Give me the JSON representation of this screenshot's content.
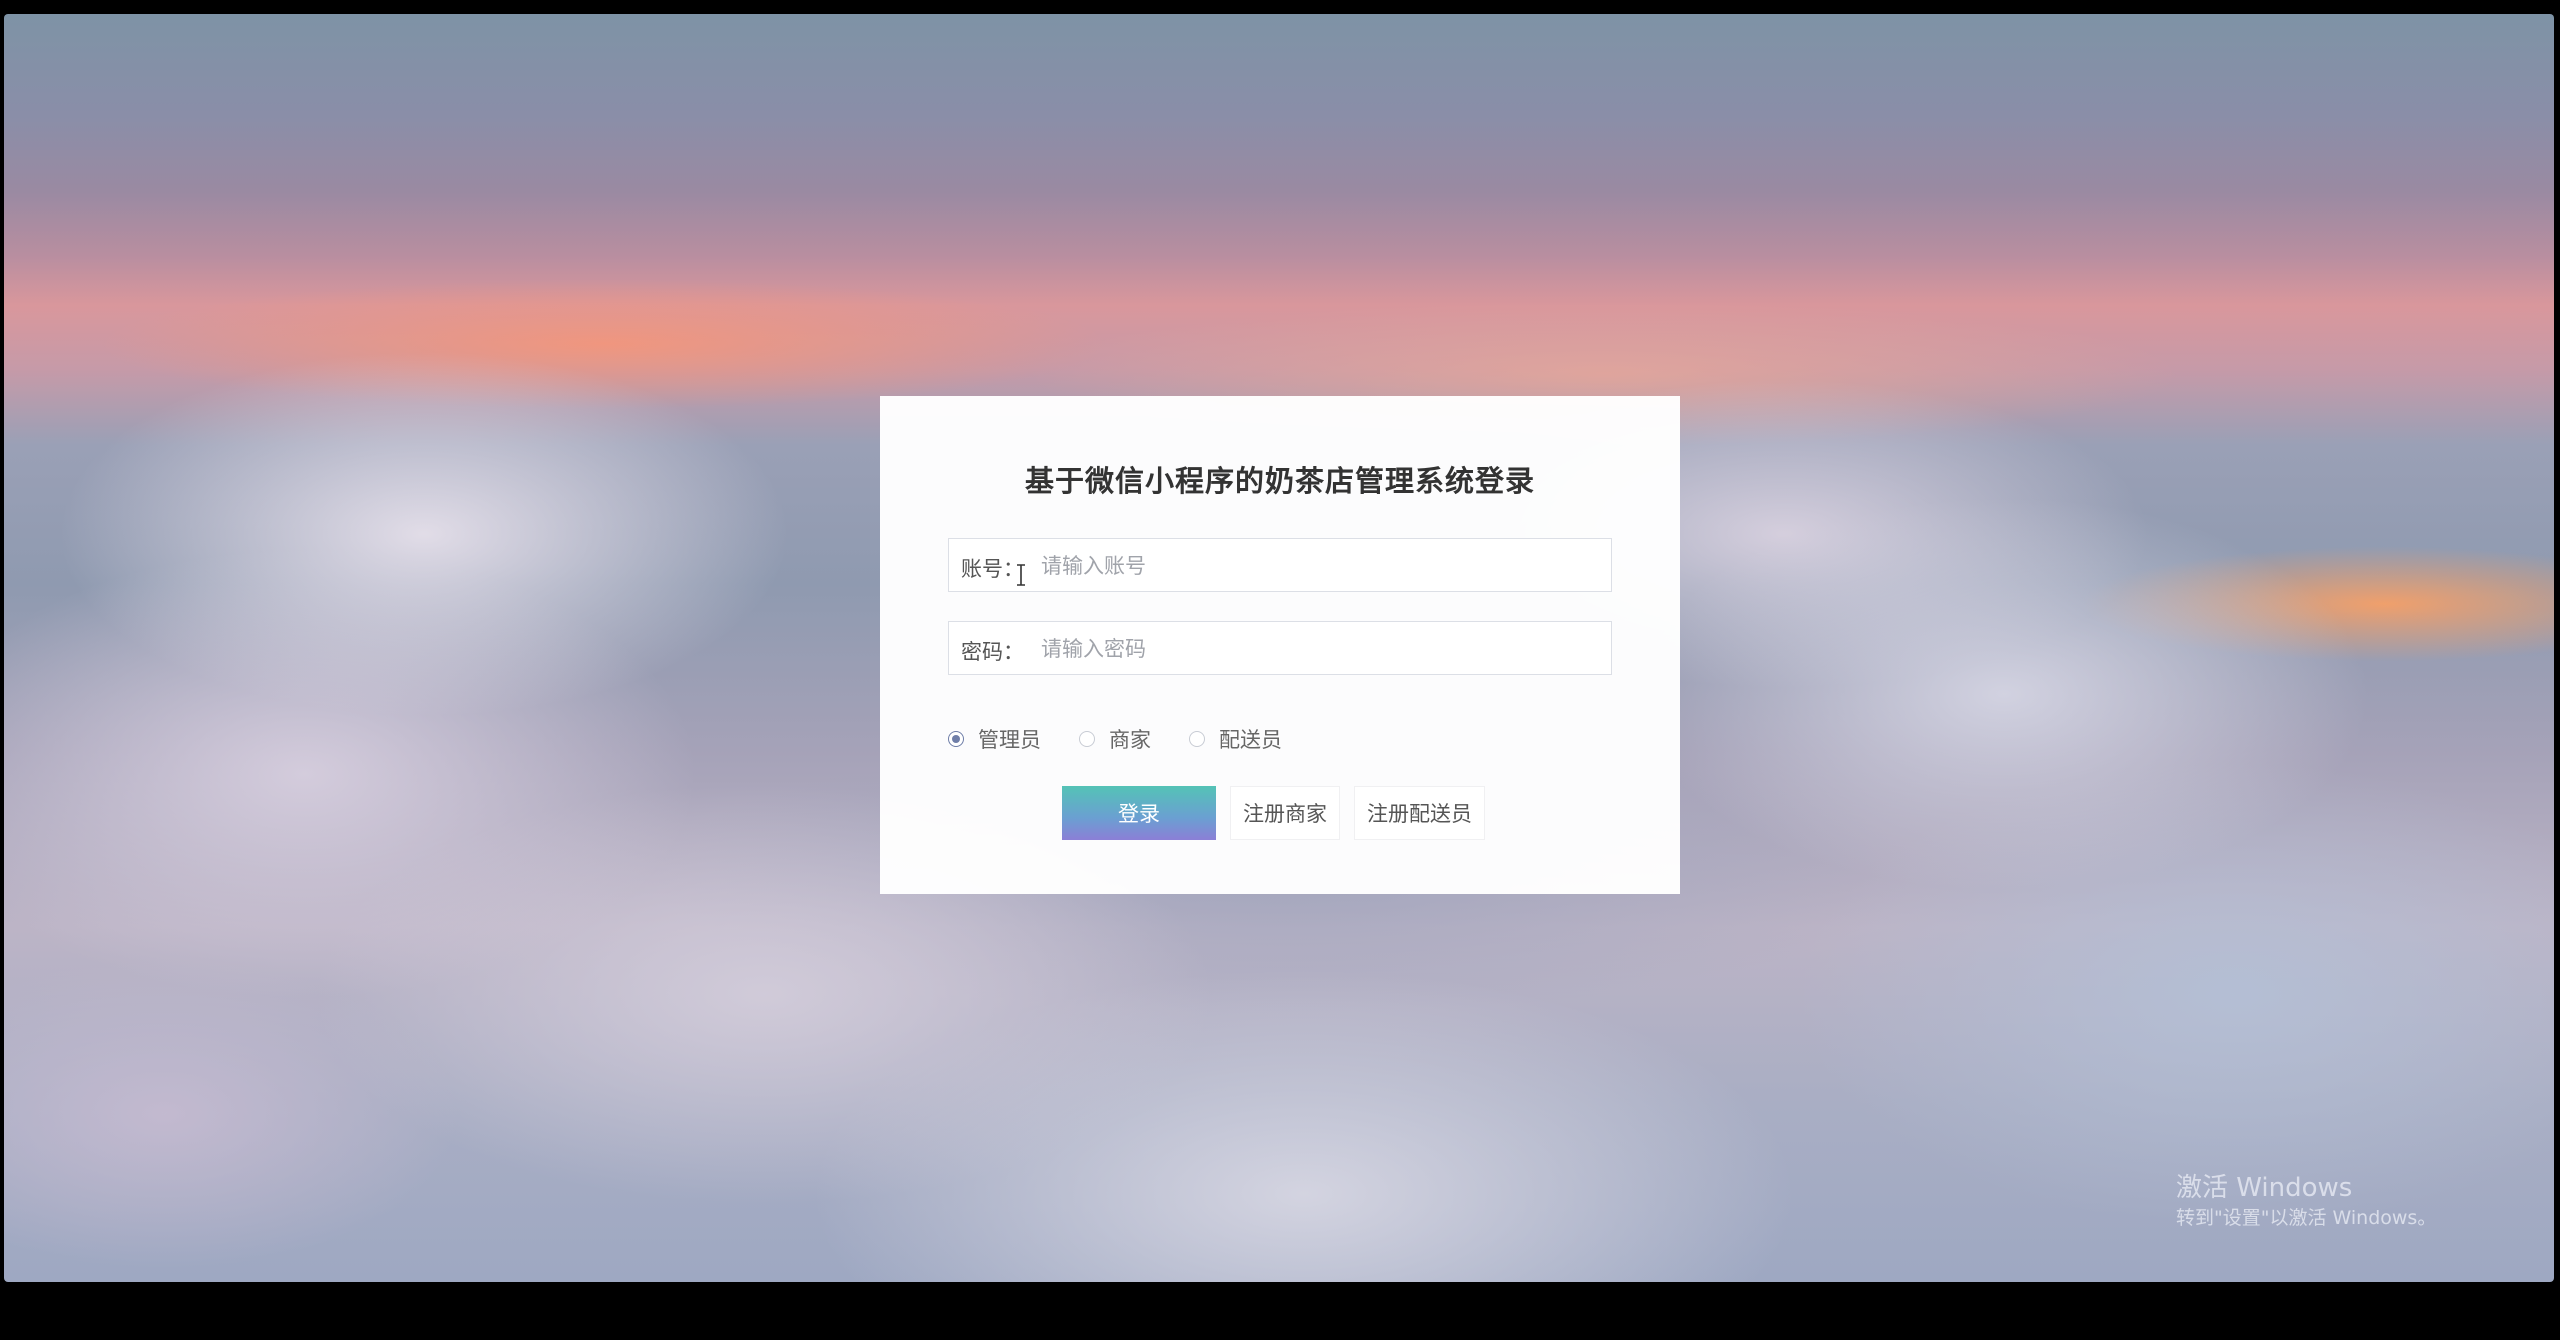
{
  "login": {
    "title": "基于微信小程序的奶茶店管理系统登录",
    "account": {
      "label": "账号：",
      "placeholder": "请输入账号",
      "value": ""
    },
    "password": {
      "label": "密码：",
      "placeholder": "请输入密码",
      "value": ""
    },
    "roles": [
      {
        "label": "管理员",
        "selected": true
      },
      {
        "label": "商家",
        "selected": false
      },
      {
        "label": "配送员",
        "selected": false
      }
    ],
    "buttons": {
      "login": "登录",
      "register_merchant": "注册商家",
      "register_courier": "注册配送员"
    }
  },
  "watermark": {
    "title": "激活 Windows",
    "subtitle": "转到\"设置\"以激活 Windows。"
  },
  "colors": {
    "accent_gradient_start": "#54c3b6",
    "accent_gradient_end": "#8b7fd6",
    "radio_checked": "#6f7ea8"
  },
  "icons": {
    "cursor": "ibeam-cursor-icon"
  }
}
